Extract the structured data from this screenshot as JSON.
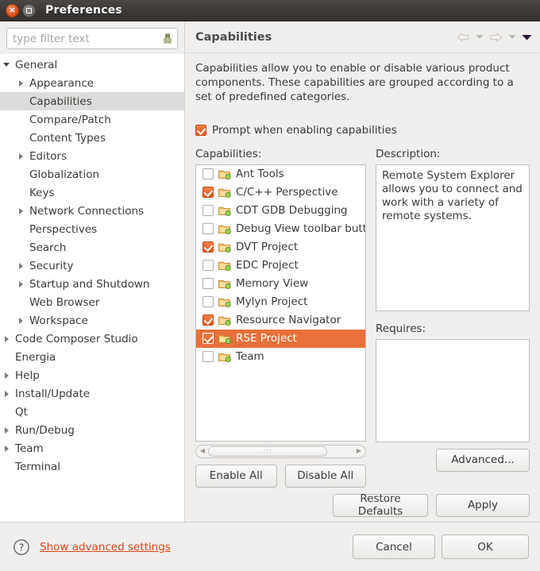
{
  "window": {
    "title": "Preferences",
    "close_label": "×",
    "maximize_label": ""
  },
  "search": {
    "placeholder": "type filter text",
    "value": "",
    "icon": "filter-icon"
  },
  "sidebar": {
    "items": [
      {
        "label": "General",
        "depth": 0,
        "expander": "down",
        "selected": false
      },
      {
        "label": "Appearance",
        "depth": 1,
        "expander": "right",
        "selected": false
      },
      {
        "label": "Capabilities",
        "depth": 1,
        "expander": "none",
        "selected": true
      },
      {
        "label": "Compare/Patch",
        "depth": 1,
        "expander": "none",
        "selected": false
      },
      {
        "label": "Content Types",
        "depth": 1,
        "expander": "none",
        "selected": false
      },
      {
        "label": "Editors",
        "depth": 1,
        "expander": "right",
        "selected": false
      },
      {
        "label": "Globalization",
        "depth": 1,
        "expander": "none",
        "selected": false
      },
      {
        "label": "Keys",
        "depth": 1,
        "expander": "none",
        "selected": false
      },
      {
        "label": "Network Connections",
        "depth": 1,
        "expander": "right",
        "selected": false
      },
      {
        "label": "Perspectives",
        "depth": 1,
        "expander": "none",
        "selected": false
      },
      {
        "label": "Search",
        "depth": 1,
        "expander": "none",
        "selected": false
      },
      {
        "label": "Security",
        "depth": 1,
        "expander": "right",
        "selected": false
      },
      {
        "label": "Startup and Shutdown",
        "depth": 1,
        "expander": "right",
        "selected": false
      },
      {
        "label": "Web Browser",
        "depth": 1,
        "expander": "none",
        "selected": false
      },
      {
        "label": "Workspace",
        "depth": 1,
        "expander": "right",
        "selected": false
      },
      {
        "label": "Code Composer Studio",
        "depth": 0,
        "expander": "right",
        "selected": false
      },
      {
        "label": "Energia",
        "depth": 0,
        "expander": "none",
        "selected": false
      },
      {
        "label": "Help",
        "depth": 0,
        "expander": "right",
        "selected": false
      },
      {
        "label": "Install/Update",
        "depth": 0,
        "expander": "right",
        "selected": false
      },
      {
        "label": "Qt",
        "depth": 0,
        "expander": "none",
        "selected": false
      },
      {
        "label": "Run/Debug",
        "depth": 0,
        "expander": "right",
        "selected": false
      },
      {
        "label": "Team",
        "depth": 0,
        "expander": "right",
        "selected": false
      },
      {
        "label": "Terminal",
        "depth": 0,
        "expander": "none",
        "selected": false
      }
    ]
  },
  "page": {
    "title": "Capabilities",
    "intro": "Capabilities allow you to enable or disable various product components. These capabilities are grouped according to a set of predefined categories.",
    "nav": {
      "back_icon": "back-arrow-icon",
      "back_menu_icon": "chevron-down-icon",
      "forward_icon": "forward-arrow-icon",
      "forward_menu_icon": "chevron-down-icon",
      "view_menu_icon": "view-menu-chevron-icon"
    },
    "prompt_checkbox": {
      "label": "Prompt when enabling capabilities",
      "checked": true
    },
    "capabilities_label": "Capabilities:",
    "capabilities": [
      {
        "label": "Ant Tools",
        "checked": false,
        "selected": false
      },
      {
        "label": "C/C++ Perspective",
        "checked": true,
        "selected": false
      },
      {
        "label": "CDT GDB Debugging",
        "checked": false,
        "selected": false
      },
      {
        "label": "Debug View toolbar butt",
        "checked": false,
        "selected": false
      },
      {
        "label": "DVT Project",
        "checked": true,
        "selected": false
      },
      {
        "label": "EDC Project",
        "checked": false,
        "selected": false
      },
      {
        "label": "Memory View",
        "checked": false,
        "selected": false
      },
      {
        "label": "Mylyn Project",
        "checked": false,
        "selected": false
      },
      {
        "label": "Resource Navigator",
        "checked": true,
        "selected": false
      },
      {
        "label": "RSE Project",
        "checked": true,
        "selected": true
      },
      {
        "label": "Team",
        "checked": false,
        "selected": false
      }
    ],
    "description_label": "Description:",
    "description_text": "Remote System Explorer allows you to connect and work with a variety of remote systems.",
    "requires_label": "Requires:",
    "requires_items": [],
    "buttons": {
      "enable_all": "Enable All",
      "disable_all": "Disable All",
      "advanced": "Advanced...",
      "restore_defaults": "Restore Defaults",
      "apply": "Apply"
    }
  },
  "footer": {
    "help_icon": "help-question-icon",
    "advanced_link": "Show advanced settings",
    "cancel": "Cancel",
    "ok": "OK"
  },
  "colors": {
    "accent_orange": "#dd4814",
    "selection_orange": "#e8703a",
    "titlebar_dark": "#3b3836",
    "panel_bg": "#f0efee"
  }
}
